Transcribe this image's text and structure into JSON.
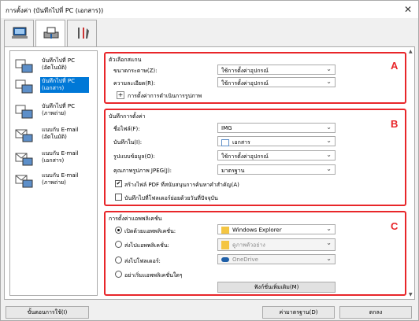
{
  "window": {
    "title": "การตั้งค่า (บันทึกไปที่ PC (เอกสาร))",
    "close_glyph": "✕"
  },
  "tabs": [
    {
      "icon": "computer-scan-icon",
      "active": false
    },
    {
      "icon": "scanner-icon",
      "active": true
    },
    {
      "icon": "tools-icon",
      "active": false
    }
  ],
  "sidebar": {
    "items": [
      {
        "label": "บันทึกไปที่ PC (อัตโนมัติ)",
        "icon": "save-pc-auto-icon",
        "selected": false
      },
      {
        "label": "บันทึกไปที่ PC (เอกสาร)",
        "icon": "save-pc-document-icon",
        "selected": true
      },
      {
        "label": "บันทึกไปที่ PC (ภาพถ่าย)",
        "icon": "save-pc-photo-icon",
        "selected": false
      },
      {
        "label": "แนบกับ E-mail (อัตโนมัติ)",
        "icon": "email-auto-icon",
        "selected": false
      },
      {
        "label": "แนบกับ E-mail (เอกสาร)",
        "icon": "email-document-icon",
        "selected": false
      },
      {
        "label": "แนบกับ E-mail (ภาพถ่าย)",
        "icon": "email-photo-icon",
        "selected": false
      }
    ]
  },
  "scan_options": {
    "title": "ตัวเลือกสแกน",
    "paper_size_label": "ขนาดกระดาษ(Z):",
    "paper_size_value": "ใช้การตั้งค่าอุปกรณ์",
    "resolution_label": "ความละเอียด(R):",
    "resolution_value": "ใช้การตั้งค่าอุปกรณ์",
    "image_processing_label": "การตั้งค่าการดำเนินการรูปภาพ",
    "marker": "A"
  },
  "save_settings": {
    "title": "บันทึกการตั้งค่า",
    "filename_label": "ชื่อไฟล์(F):",
    "filename_value": "IMG",
    "save_in_label": "บันทึกใน(I):",
    "save_in_value": "เอกสาร",
    "data_format_label": "รูปแบบข้อมูล(O):",
    "data_format_value": "ใช้การตั้งค่าอุปกรณ์",
    "jpeg_quality_label": "คุณภาพรูปภาพ JPEG(J):",
    "jpeg_quality_value": "มาตรฐาน",
    "pdf_keyword_label": "สร้างไฟล์ PDF ที่สนับสนุนการค้นหาคำสำคัญ(A)",
    "pdf_keyword_checked": true,
    "subfolder_label": "บันทึกไปที่โฟลเดอร์ย่อยด้วยวันที่ปัจจุบัน",
    "subfolder_checked": false,
    "marker": "B"
  },
  "app_settings": {
    "title": "การตั้งค่าแอพพลิเคชั่น",
    "open_app_label": "เปิดด้วยแอพพลิเคชั่น:",
    "open_app_value": "Windows Explorer",
    "open_app_selected": true,
    "send_app_label": "ส่งไปแอพพลิเคชั่น:",
    "send_app_value": "ดูภาพตัวอย่าง",
    "send_folder_label": "ส่งไปโฟลเดอร์:",
    "send_folder_value": "OneDrive",
    "no_app_label": "อย่าเริ่มแอพพลิเคชั่นใดๆ",
    "more_functions_label": "ฟังก์ชั่นเพิ่มเติม(M)",
    "marker": "C"
  },
  "footer": {
    "instructions_label": "ขั้นตอนการใช้(I)",
    "defaults_label": "ค่ามาตรฐาน(D)",
    "ok_label": "ตกลง"
  }
}
